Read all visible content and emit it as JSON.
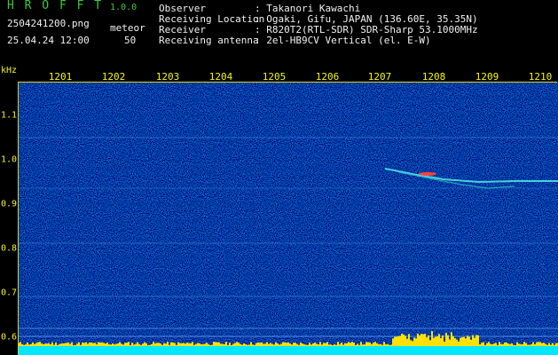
{
  "header": {
    "app_title": "H R O F F T",
    "app_version": "1.0.0",
    "file_name": "2504241200.png",
    "meteor_label": "meteor",
    "datetime": "25.04.24 12:00",
    "meteor_count": "50"
  },
  "station": [
    {
      "label": "Observer",
      "value": ": Takanori Kawachi"
    },
    {
      "label": "Receiving Location",
      "value": ": Ogaki, Gifu, JAPAN (136.60E, 35.35N)"
    },
    {
      "label": "Receiver",
      "value": ": R820T2(RTL-SDR) SDR-Sharp 53.1000MHz"
    },
    {
      "label": "Receiving antenna",
      "value": ": 2el-HB9CV Vertical (el. E-W)"
    }
  ],
  "axes": {
    "y_unit": "kHz",
    "x_ticks": [
      "1201",
      "1202",
      "1203",
      "1204",
      "1205",
      "1206",
      "1207",
      "1208",
      "1209",
      "1210"
    ],
    "y_ticks": [
      "1.1",
      "1.0",
      "0.9",
      "0.8",
      "0.7",
      "0.6"
    ]
  },
  "colors": {
    "background": "#000000",
    "header_green": "#3ec83e",
    "header_white": "#f0f0f0",
    "axis_yellow": "#f4f414",
    "noise_base": "#10106a"
  }
}
